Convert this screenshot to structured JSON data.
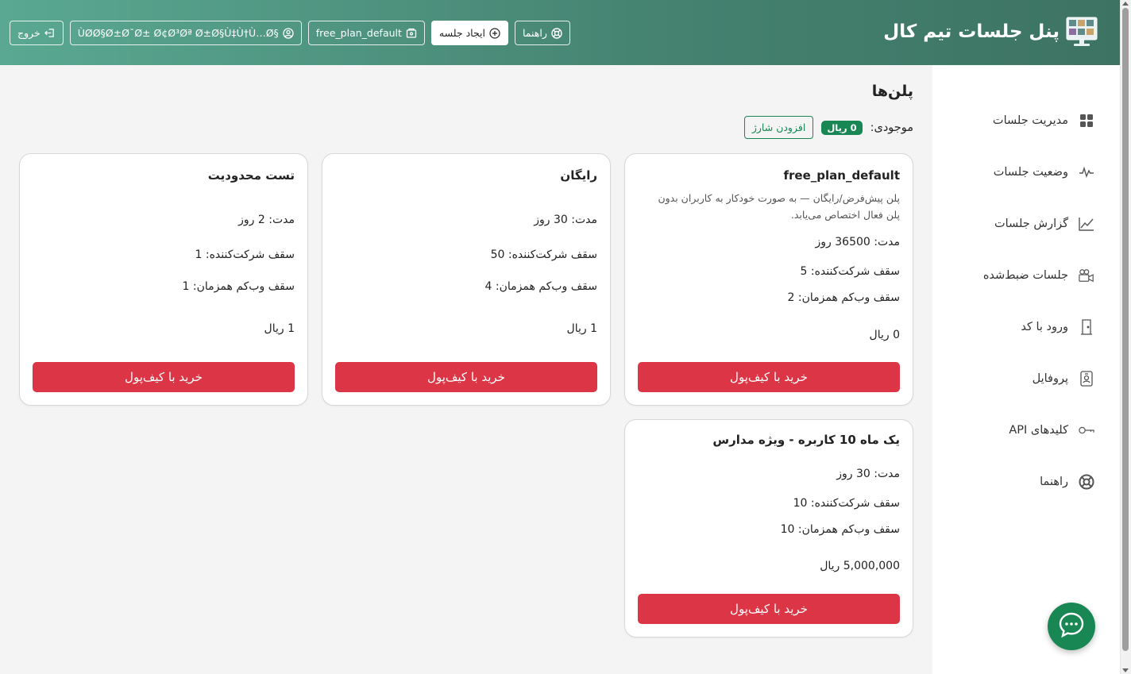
{
  "header": {
    "title": "پنل جلسات تیم کال",
    "buttons": {
      "guide": "راهنما",
      "create_session": "ایجاد جلسه",
      "plan": "free_plan_default",
      "user": "§ÙØØ§Ø±Ø¯Ø± Ø¢Ø³Øª Ø±Ø§Ù‡Ù†Ù…Ø",
      "logout": "خروج"
    }
  },
  "sidebar": {
    "items": [
      {
        "label": "مدیریت جلسات",
        "icon": "grid-icon"
      },
      {
        "label": "وضعیت جلسات",
        "icon": "pulse-icon"
      },
      {
        "label": "گزارش جلسات",
        "icon": "chart-icon"
      },
      {
        "label": "جلسات ضبط‌شده",
        "icon": "camera-icon"
      },
      {
        "label": "ورود با کد",
        "icon": "door-icon"
      },
      {
        "label": "پروفایل",
        "icon": "badge-icon"
      },
      {
        "label": "کلیدهای API",
        "icon": "key-icon"
      },
      {
        "label": "راهنما",
        "icon": "lifebuoy-icon"
      }
    ]
  },
  "main": {
    "title": "پلن‌ها",
    "balance_label": "موجودی:",
    "balance_value": "0 ریال",
    "charge_button": "افزودن شارژ"
  },
  "plans": [
    {
      "name": "free_plan_default",
      "description": "پلن پیش‌فرض/رایگان — به صورت خودکار به کاربران بدون پلن فعال اختصاص می‌یابد.",
      "duration": "مدت: 36500 روز",
      "participants": "سقف شرکت‌کننده: 5",
      "webcams": "سقف وب‌کم همزمان: 2",
      "price": "0 ریال",
      "buy": "خرید با کیف‌پول"
    },
    {
      "name": "رایگان",
      "duration": "مدت: 30 روز",
      "participants": "سقف شرکت‌کننده: 50",
      "webcams": "سقف وب‌کم همزمان: 4",
      "price": "1 ریال",
      "buy": "خرید با کیف‌پول"
    },
    {
      "name": "تست محدودیت",
      "duration": "مدت: 2 روز",
      "participants": "سقف شرکت‌کننده: 1",
      "webcams": "سقف وب‌کم همزمان: 1",
      "price": "1 ریال",
      "buy": "خرید با کیف‌پول"
    },
    {
      "name": "یک ماه 10 کاربره - ویژه مدارس",
      "duration": "مدت: 30 روز",
      "participants": "سقف شرکت‌کننده: 10",
      "webcams": "سقف وب‌کم همزمان: 10",
      "price": "5,000,000 ریال",
      "buy": "خرید با کیف‌پول"
    }
  ],
  "colors": {
    "primary_green": "#198754",
    "danger_red": "#dc3545",
    "header_start": "#5aa891",
    "header_end": "#3d7363"
  }
}
